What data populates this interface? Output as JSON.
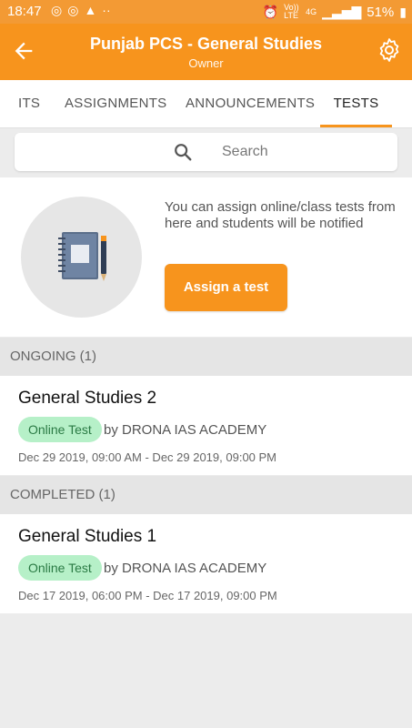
{
  "status_bar": {
    "time": "18:47",
    "network": "Vo)) LTE",
    "signal": "4G",
    "battery": "51%"
  },
  "app_bar": {
    "title": "Punjab PCS - General Studies",
    "subtitle": "Owner"
  },
  "tabs": [
    {
      "label": "ITS"
    },
    {
      "label": "ASSIGNMENTS"
    },
    {
      "label": "ANNOUNCEMENTS"
    },
    {
      "label": "TESTS",
      "active": true
    }
  ],
  "search": {
    "placeholder": "Search"
  },
  "promo": {
    "description": "You can assign online/class tests from here and students will be notified",
    "button_label": "Assign a test"
  },
  "sections": {
    "ongoing": {
      "header": "ONGOING (1)",
      "items": [
        {
          "name": "General Studies 2",
          "badge": "Online Test",
          "by": "by DRONA IAS ACADEMY",
          "dates": "Dec 29 2019, 09:00 AM - Dec 29 2019, 09:00 PM"
        }
      ]
    },
    "completed": {
      "header": "COMPLETED (1)",
      "items": [
        {
          "name": "General Studies 1",
          "badge": "Online Test",
          "by": "by DRONA IAS ACADEMY",
          "dates": "Dec 17 2019, 06:00 PM - Dec 17 2019, 09:00 PM"
        }
      ]
    }
  },
  "colors": {
    "accent": "#f7941d",
    "badge_bg": "#b6f0c8",
    "badge_text": "#2a7a44"
  }
}
